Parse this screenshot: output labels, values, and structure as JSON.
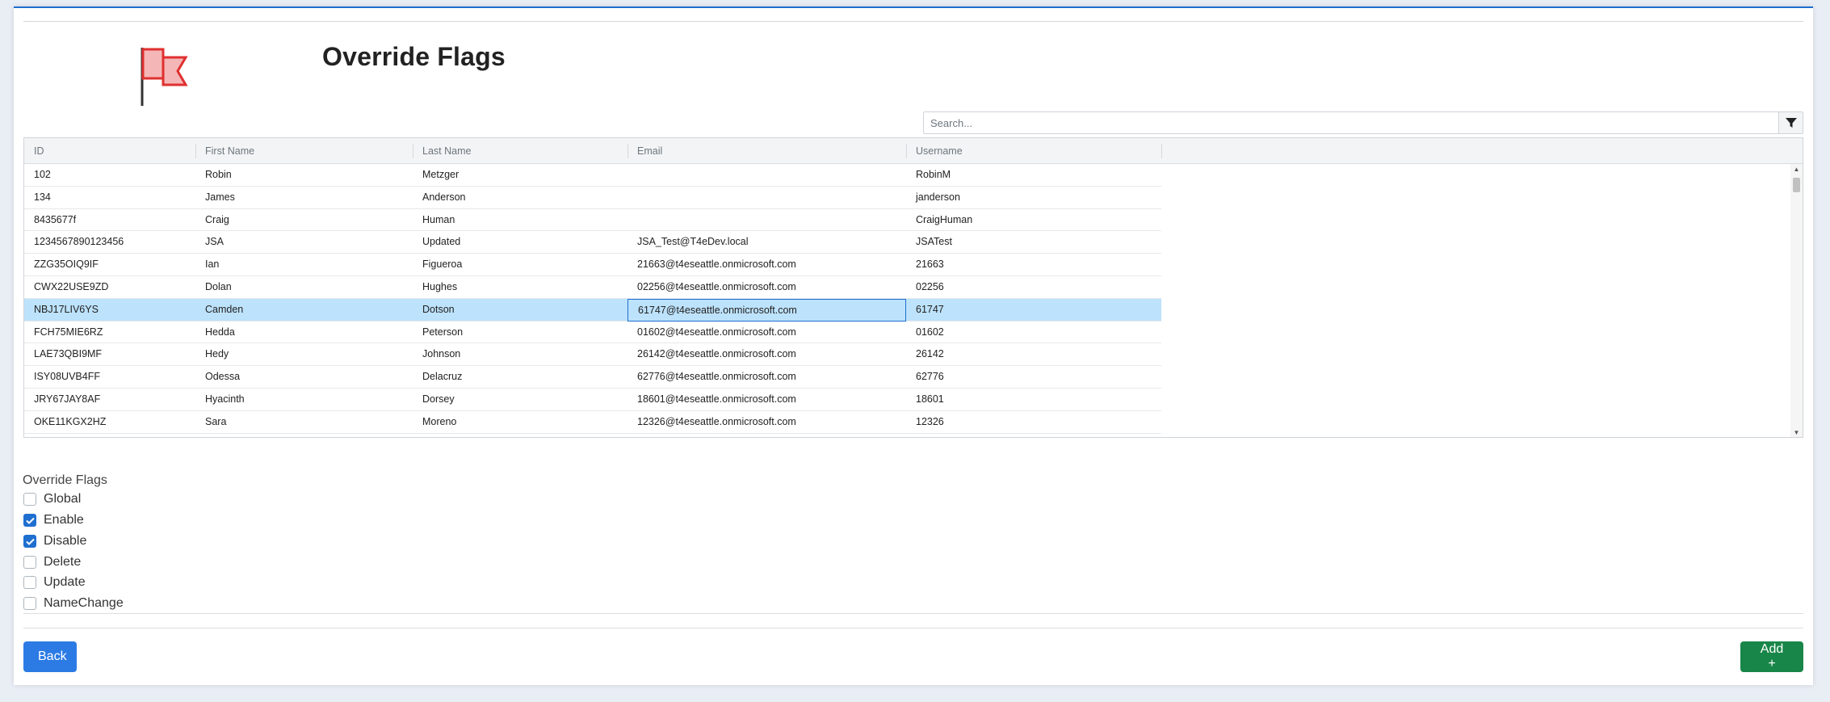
{
  "page": {
    "title": "Override Flags",
    "accent_color": "#1f6fd0",
    "flag_icon": "flag-icon"
  },
  "search": {
    "placeholder": "Search...",
    "value": "",
    "filter_icon": "filter-icon"
  },
  "grid": {
    "columns": [
      "ID",
      "First Name",
      "Last Name",
      "Email",
      "Username"
    ],
    "selected_row_index": 6,
    "selected_highlight_color": "#bde2fb",
    "rows": [
      {
        "id": "102",
        "first": "Robin",
        "last": "Metzger",
        "email": "",
        "username": "RobinM"
      },
      {
        "id": "134",
        "first": "James",
        "last": "Anderson",
        "email": "",
        "username": "janderson"
      },
      {
        "id": "8435677f",
        "first": "Craig",
        "last": "Human",
        "email": "",
        "username": "CraigHuman"
      },
      {
        "id": "1234567890123456",
        "first": "JSA",
        "last": "Updated",
        "email": "JSA_Test@T4eDev.local",
        "username": "JSATest"
      },
      {
        "id": "ZZG35OIQ9IF",
        "first": "Ian",
        "last": "Figueroa",
        "email": "21663@t4eseattle.onmicrosoft.com",
        "username": "21663"
      },
      {
        "id": "CWX22USE9ZD",
        "first": "Dolan",
        "last": "Hughes",
        "email": "02256@t4eseattle.onmicrosoft.com",
        "username": "02256"
      },
      {
        "id": "NBJ17LIV6YS",
        "first": "Camden",
        "last": "Dotson",
        "email": "61747@t4eseattle.onmicrosoft.com",
        "username": "61747"
      },
      {
        "id": "FCH75MIE6RZ",
        "first": "Hedda",
        "last": "Peterson",
        "email": "01602@t4eseattle.onmicrosoft.com",
        "username": "01602"
      },
      {
        "id": "LAE73QBI9MF",
        "first": "Hedy",
        "last": "Johnson",
        "email": "26142@t4eseattle.onmicrosoft.com",
        "username": "26142"
      },
      {
        "id": "ISY08UVB4FF",
        "first": "Odessa",
        "last": "Delacruz",
        "email": "62776@t4eseattle.onmicrosoft.com",
        "username": "62776"
      },
      {
        "id": "JRY67JAY8AF",
        "first": "Hyacinth",
        "last": "Dorsey",
        "email": "18601@t4eseattle.onmicrosoft.com",
        "username": "18601"
      },
      {
        "id": "OKE11KGX2HZ",
        "first": "Sara",
        "last": "Moreno",
        "email": "12326@t4eseattle.onmicrosoft.com",
        "username": "12326"
      }
    ]
  },
  "override_flags": {
    "heading": "Override Flags",
    "options": [
      {
        "label": "Global",
        "checked": false
      },
      {
        "label": "Enable",
        "checked": true
      },
      {
        "label": "Disable",
        "checked": true
      },
      {
        "label": "Delete",
        "checked": false
      },
      {
        "label": "Update",
        "checked": false
      },
      {
        "label": "NameChange",
        "checked": false
      }
    ]
  },
  "actions": {
    "back_label": "Back",
    "add_label": "Add +",
    "back_color": "#2c7be5",
    "add_color": "#198649"
  }
}
